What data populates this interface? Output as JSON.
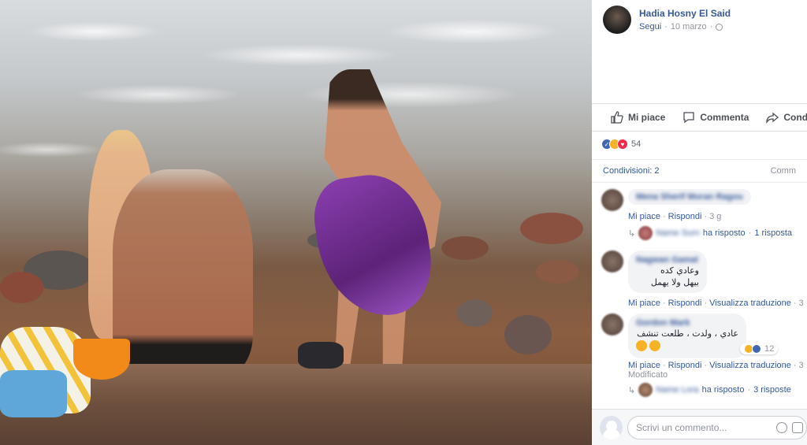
{
  "post": {
    "author": "Hadia Hosny El Said",
    "follow": "Segui",
    "date": "10 marzo",
    "sep": "·"
  },
  "actions": {
    "like": "Mi piace",
    "comment": "Commenta",
    "share": "Condi"
  },
  "reactions": {
    "count": "54",
    "types": [
      "like",
      "wow",
      "love"
    ]
  },
  "stats": {
    "shares": "Condivisioni: 2",
    "comments": "Comm"
  },
  "comments": [
    {
      "name": "Mena Sherif Moran Ragou",
      "links": [
        "Mi piace",
        "Rispondi"
      ],
      "time": "3 g",
      "replies_who": "ha risposto",
      "replies_count": "1 risposta"
    },
    {
      "name": "Nagwan Gamal",
      "text_line1": "وعادي كده",
      "text_line2": "بيهل ولا يهمل",
      "links": [
        "Mi piace",
        "Rispondi",
        "Visualizza traduzione"
      ],
      "time": "3"
    },
    {
      "name": "Gordon Mark",
      "text_line1": "عادي ، ولدت ، طلعت تنشف",
      "reaction_count": "12",
      "links": [
        "Mi piace",
        "Rispondi",
        "Visualizza traduzione"
      ],
      "time": "3",
      "edited": "Modificato",
      "replies_who": "ha risposto",
      "replies_count": "3 risposte"
    }
  ],
  "composer": {
    "placeholder": "Scrivi un commento..."
  },
  "colors": {
    "link": "#365899",
    "muted": "#90949c",
    "like": "#4267b2",
    "love": "#f0284a",
    "wow": "#f7b125"
  }
}
